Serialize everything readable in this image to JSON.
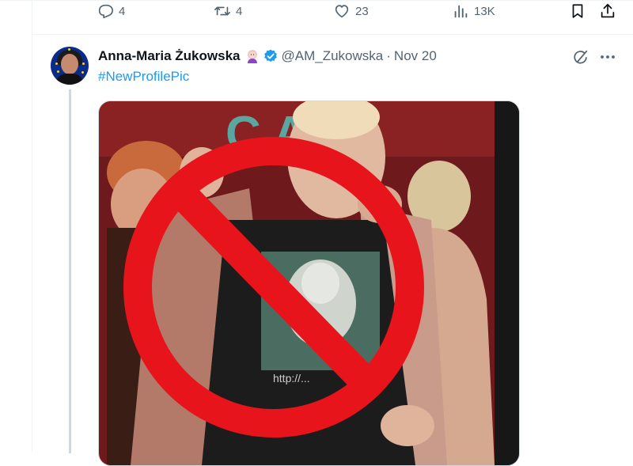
{
  "prev_actions": {
    "replies": "4",
    "reposts": "4",
    "likes": "23",
    "views": "13K"
  },
  "tweet": {
    "author_name": "Anna-Maria Żukowska",
    "handle": "@AM_Zukowska",
    "separator": "·",
    "date": "Nov 20",
    "text": "#NewProfilePic",
    "image_text": "http://..."
  },
  "icons": {
    "reply": "reply-icon",
    "repost": "repost-icon",
    "like": "like-icon",
    "views": "views-icon",
    "bookmark": "bookmark-icon",
    "share": "share-icon",
    "verified": "verified-icon",
    "emoji": "woman-tipping-hand-emoji",
    "grok": "grok-icon",
    "more": "more-icon"
  },
  "colors": {
    "accent": "#1d9bf0",
    "muted": "#536471",
    "prohibition_red": "#e8141b"
  }
}
